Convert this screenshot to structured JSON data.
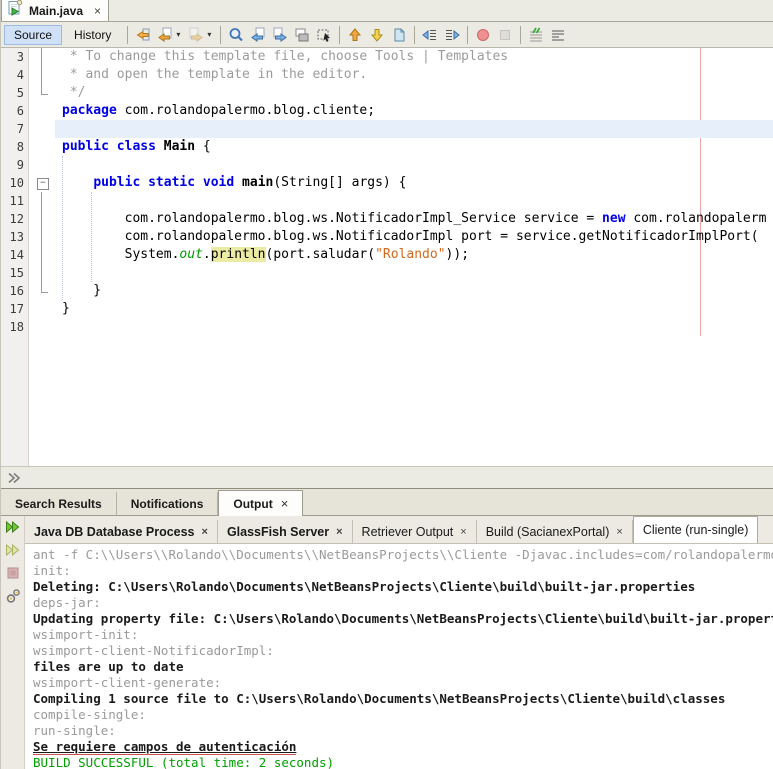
{
  "file_tab": {
    "title": "Main.java",
    "close_label": "×",
    "icon": "java-main-class-icon"
  },
  "toolbar": {
    "source_label": "Source",
    "history_label": "History",
    "icons": [
      {
        "icon": "last-edit-location-icon"
      },
      {
        "icon": "back-icon",
        "caret": true
      },
      {
        "icon": "forward-icon",
        "caret": true,
        "disabled": true
      },
      {
        "sep": true
      },
      {
        "icon": "find-selection-icon"
      },
      {
        "icon": "find-previous-occurrence-icon"
      },
      {
        "icon": "find-next-occurrence-icon"
      },
      {
        "icon": "toggle-highlight-search-icon"
      },
      {
        "icon": "rectangular-selection-icon"
      },
      {
        "sep": true
      },
      {
        "icon": "previous-bookmark-icon"
      },
      {
        "icon": "next-bookmark-icon"
      },
      {
        "icon": "toggle-bookmark-icon"
      },
      {
        "sep": true
      },
      {
        "icon": "shift-left-icon"
      },
      {
        "icon": "shift-right-icon"
      },
      {
        "sep": true
      },
      {
        "icon": "start-macro-recording-icon"
      },
      {
        "icon": "stop-macro-recording-icon",
        "disabled": true
      },
      {
        "sep": true
      },
      {
        "icon": "comment-icon"
      },
      {
        "icon": "uncomment-icon"
      }
    ]
  },
  "editor": {
    "caret_line": 7,
    "lines": [
      {
        "n": 3,
        "fold": "mid",
        "tokens": [
          [
            "com",
            " * To change this template file, choose Tools | Templates"
          ]
        ]
      },
      {
        "n": 4,
        "fold": "mid",
        "tokens": [
          [
            "com",
            " * and open the template in the editor."
          ]
        ]
      },
      {
        "n": 5,
        "fold": "end",
        "tokens": [
          [
            "com",
            " */"
          ]
        ]
      },
      {
        "n": 6,
        "fold": "",
        "tokens": [
          [
            "kw",
            "package"
          ],
          [
            "p",
            " com.rolandopalermo.blog.cliente;"
          ]
        ]
      },
      {
        "n": 7,
        "fold": "",
        "tokens": []
      },
      {
        "n": 8,
        "fold": "",
        "tokens": [
          [
            "kw",
            "public"
          ],
          [
            "p",
            " "
          ],
          [
            "kw",
            "class"
          ],
          [
            "b",
            " Main"
          ],
          [
            "p",
            " {"
          ]
        ]
      },
      {
        "n": 9,
        "fold": "",
        "tokens": []
      },
      {
        "n": 10,
        "fold": "box",
        "tokens": [
          [
            "p",
            "    "
          ],
          [
            "kw",
            "public"
          ],
          [
            "p",
            " "
          ],
          [
            "kw",
            "static"
          ],
          [
            "p",
            " "
          ],
          [
            "kw",
            "void"
          ],
          [
            "p",
            " "
          ],
          [
            "b",
            "main"
          ],
          [
            "p",
            "(String[] args) {"
          ]
        ]
      },
      {
        "n": 11,
        "fold": "mid",
        "tokens": []
      },
      {
        "n": 12,
        "fold": "mid",
        "tokens": [
          [
            "p",
            "        com.rolandopalermo.blog.ws.NotificadorImpl_Service service = "
          ],
          [
            "kw",
            "new"
          ],
          [
            "p",
            " com.rolandopalerm"
          ]
        ]
      },
      {
        "n": 13,
        "fold": "mid",
        "tokens": [
          [
            "p",
            "        com.rolandopalermo.blog.ws.NotificadorImpl port = service.getNotificadorImplPort("
          ]
        ]
      },
      {
        "n": 14,
        "fold": "mid",
        "tokens": [
          [
            "p",
            "        System."
          ],
          [
            "fld",
            "out"
          ],
          [
            "p",
            "."
          ],
          [
            "hl",
            "println"
          ],
          [
            "p",
            "(port.saludar("
          ],
          [
            "str",
            "\"Rolando\""
          ],
          [
            "p",
            "));"
          ]
        ]
      },
      {
        "n": 15,
        "fold": "mid",
        "tokens": []
      },
      {
        "n": 16,
        "fold": "end",
        "tokens": [
          [
            "p",
            "    }"
          ]
        ]
      },
      {
        "n": 17,
        "fold": "",
        "tokens": [
          [
            "p",
            "}"
          ]
        ]
      },
      {
        "n": 18,
        "fold": "",
        "tokens": []
      }
    ],
    "colors": {
      "keyword": "#0000e6",
      "comment": "#9b9b9b",
      "string": "#d2691e",
      "field": "#009900",
      "occurrence_highlight": "#eceba3",
      "caret_row": "#e7effb",
      "right_margin": "#e8a8a8"
    }
  },
  "breadcrumb": {
    "icon": "breadcrumb-chevron-icon"
  },
  "window_tabs": [
    {
      "label": "Search Results",
      "active": false
    },
    {
      "label": "Notifications",
      "active": false
    },
    {
      "label": "Output",
      "active": true,
      "closable": true,
      "close_label": "×"
    }
  ],
  "output": {
    "side_buttons": [
      {
        "icon": "rerun-icon"
      },
      {
        "icon": "rerun-with-different-parameters-icon"
      },
      {
        "icon": "stop-build-icon",
        "disabled": true
      },
      {
        "icon": "ant-settings-icon"
      }
    ],
    "tabs": [
      {
        "label": "Java DB Database Process",
        "bold": true,
        "closable": true,
        "close_label": "×"
      },
      {
        "label": "GlassFish Server",
        "bold": true,
        "closable": true,
        "close_label": "×"
      },
      {
        "label": "Retriever Output",
        "bold": false,
        "closable": true,
        "close_label": "×"
      },
      {
        "label": "Build (SacianexPortal)",
        "bold": false,
        "closable": true,
        "close_label": "×"
      },
      {
        "label": "Cliente (run-single)",
        "bold": false,
        "closable": false,
        "selected": true
      }
    ],
    "console": [
      [
        "gray",
        "ant -f C:\\\\Users\\\\Rolando\\\\Documents\\\\NetBeansProjects\\\\Cliente -Djavac.includes=com/rolandopalermo/blog"
      ],
      [
        "gray",
        "init:"
      ],
      [
        "black",
        "Deleting: C:\\Users\\Rolando\\Documents\\NetBeansProjects\\Cliente\\build\\built-jar.properties"
      ],
      [
        "gray",
        "deps-jar:"
      ],
      [
        "black",
        "Updating property file: C:\\Users\\Rolando\\Documents\\NetBeansProjects\\Cliente\\build\\built-jar.properties"
      ],
      [
        "gray",
        "wsimport-init:"
      ],
      [
        "gray",
        "wsimport-client-NotificadorImpl:"
      ],
      [
        "black",
        "files are up to date"
      ],
      [
        "gray",
        "wsimport-client-generate:"
      ],
      [
        "black",
        "Compiling 1 source file to C:\\Users\\Rolando\\Documents\\NetBeansProjects\\Cliente\\build\\classes"
      ],
      [
        "gray",
        "compile-single:"
      ],
      [
        "gray",
        "run-single:"
      ],
      [
        "link",
        "Se requiere campos de autenticación"
      ],
      [
        "green",
        "BUILD SUCCESSFUL (total time: 2 seconds)"
      ]
    ],
    "status_color_success": "#00a000"
  }
}
